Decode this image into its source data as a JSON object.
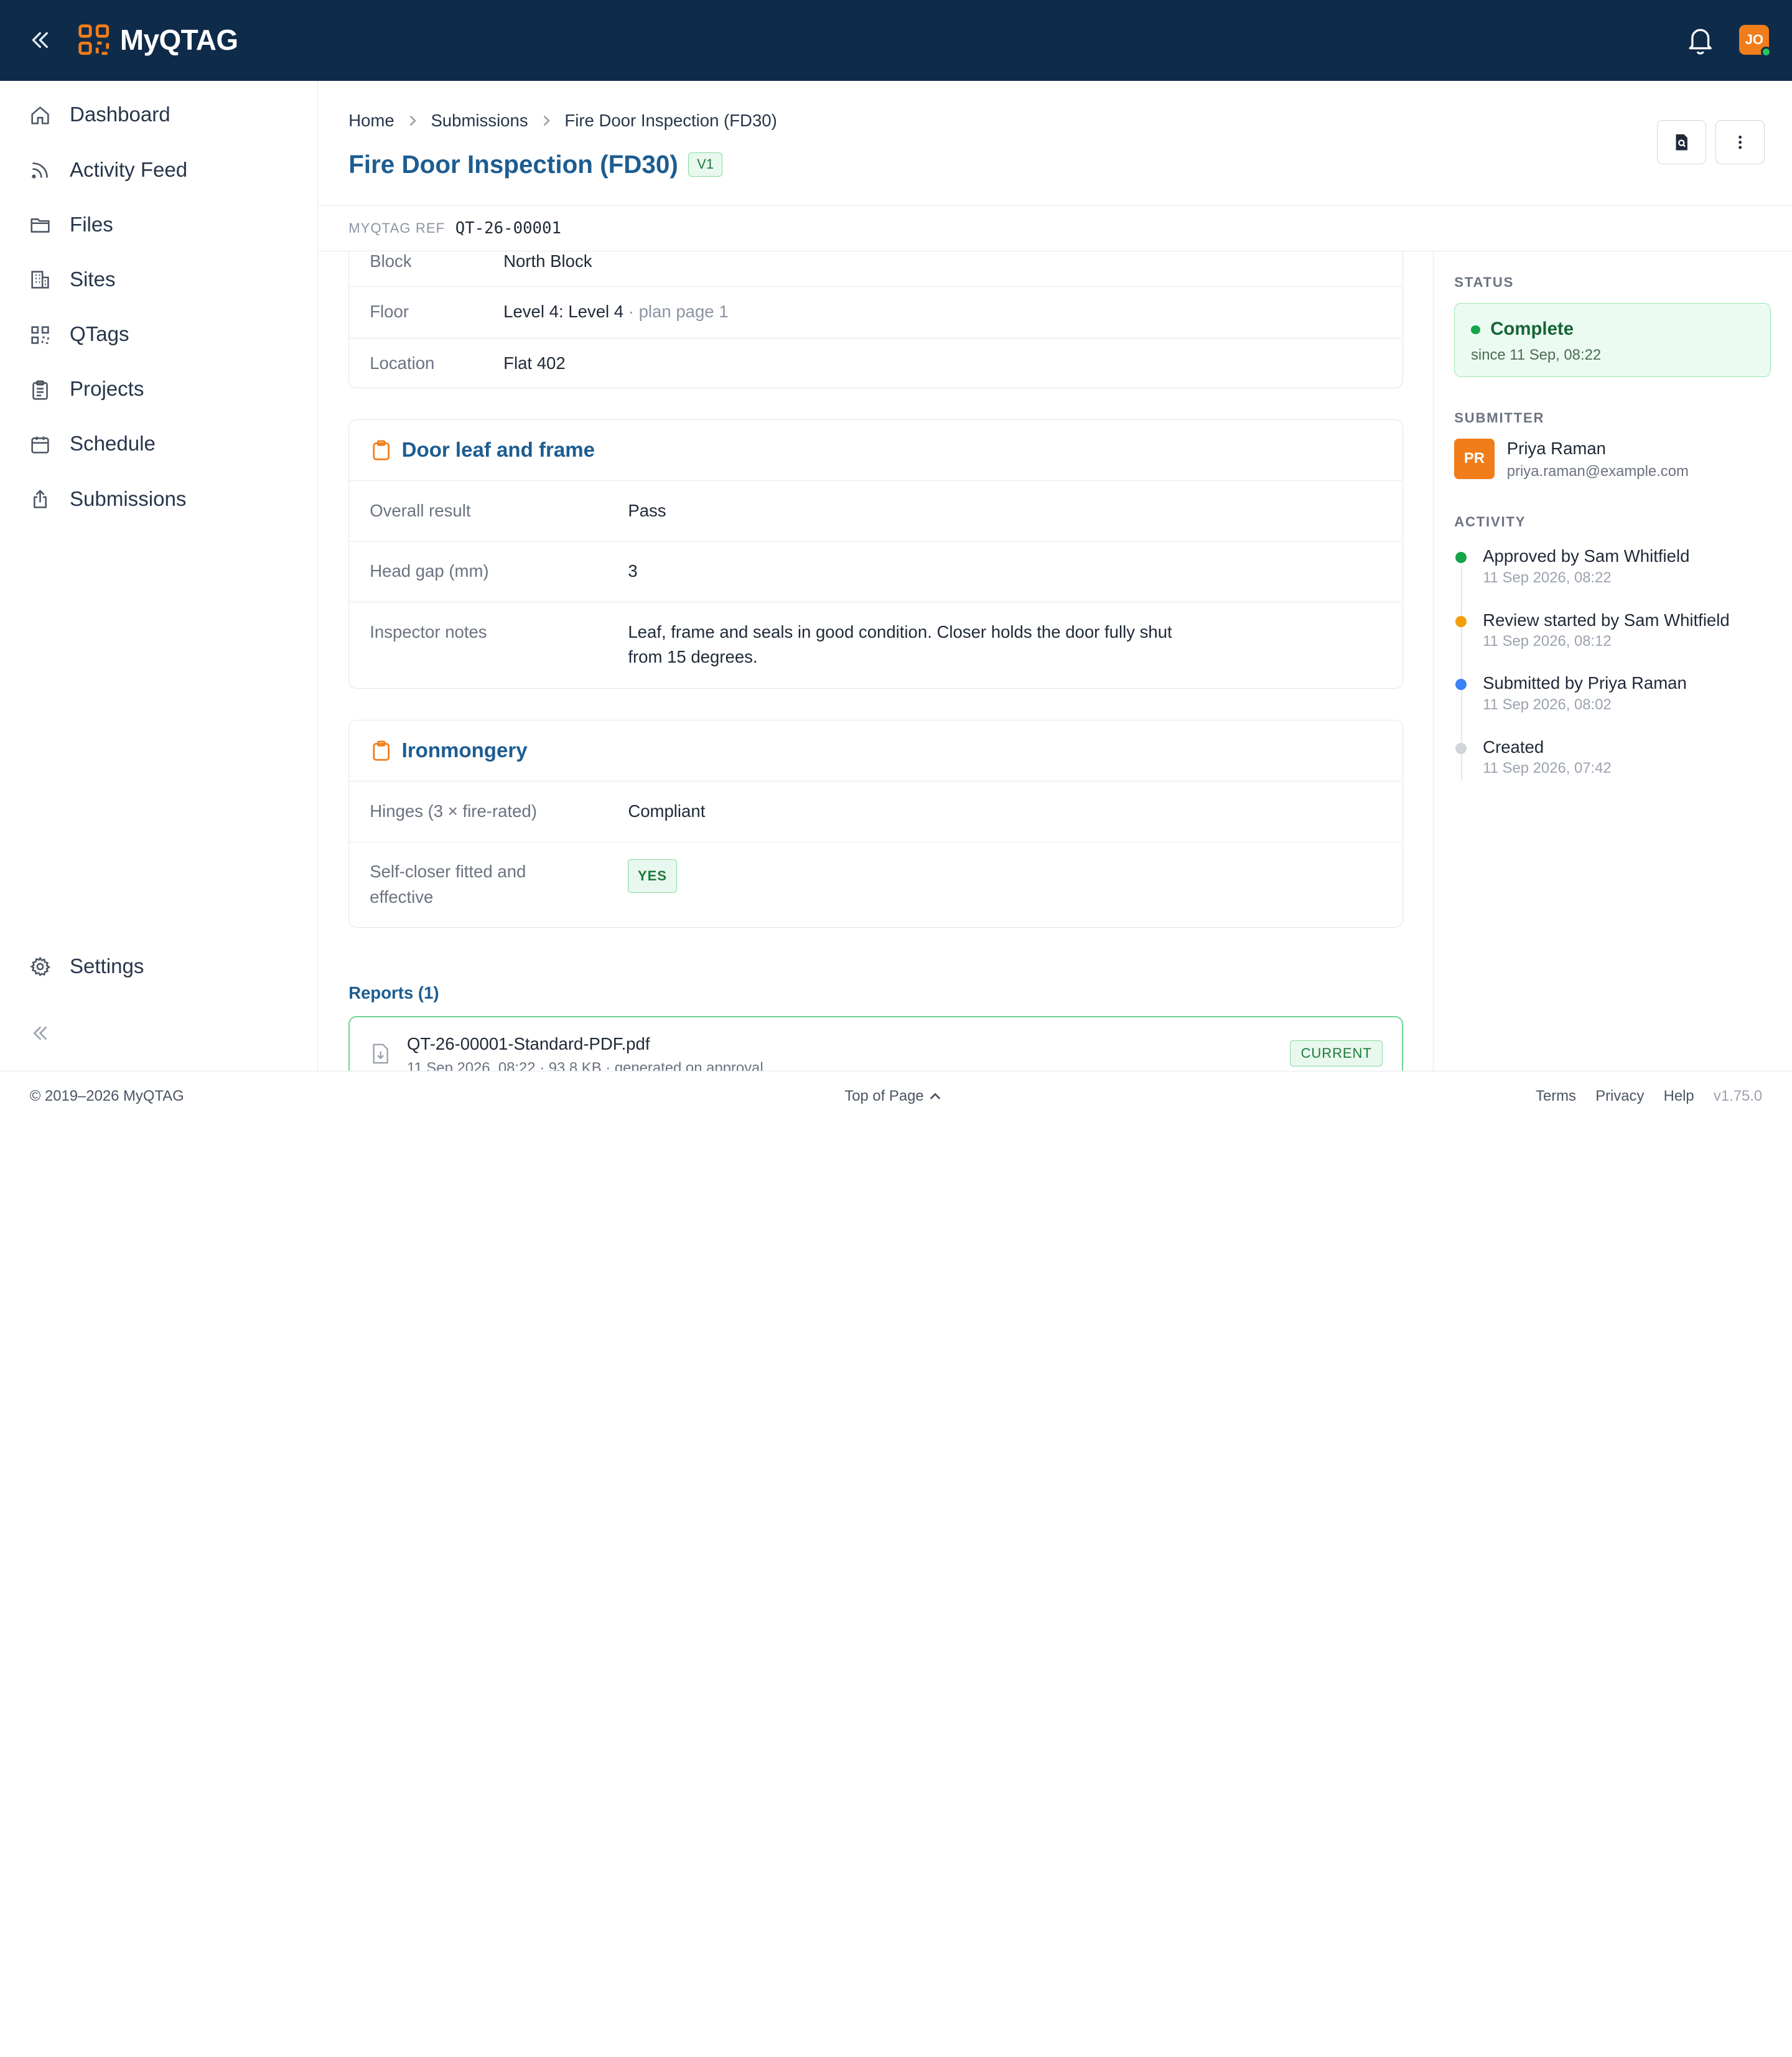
{
  "app": {
    "name": "MyQTAG",
    "user_initials": "JO"
  },
  "sidebar": {
    "items": [
      {
        "label": "Dashboard",
        "icon": "home-icon"
      },
      {
        "label": "Activity Feed",
        "icon": "rss-icon"
      },
      {
        "label": "Files",
        "icon": "folder-icon"
      },
      {
        "label": "Sites",
        "icon": "building-icon"
      },
      {
        "label": "QTags",
        "icon": "qr-icon"
      },
      {
        "label": "Projects",
        "icon": "clipboard-icon"
      },
      {
        "label": "Schedule",
        "icon": "calendar-icon"
      },
      {
        "label": "Submissions",
        "icon": "upload-icon"
      }
    ],
    "settings_label": "Settings"
  },
  "breadcrumb": [
    "Home",
    "Submissions",
    "Fire Door Inspection (FD30)"
  ],
  "page": {
    "title": "Fire Door Inspection (FD30)",
    "version": "V1"
  },
  "ref": {
    "label": "MYQTAG REF",
    "value": "QT-26-00001"
  },
  "location_fields": [
    {
      "key": "Block",
      "value": "North Block",
      "extra": ""
    },
    {
      "key": "Floor",
      "value": "Level 4: Level 4",
      "extra": " · plan page 1"
    },
    {
      "key": "Location",
      "value": "Flat 402",
      "extra": ""
    }
  ],
  "sections": [
    {
      "title": "Door leaf and frame",
      "rows": [
        {
          "key": "Overall result",
          "value": "Pass"
        },
        {
          "key": "Head gap (mm)",
          "value": "3"
        },
        {
          "key": "Inspector notes",
          "value": "Leaf, frame and seals in good condition. Closer holds the door fully shut",
          "value2": "from 15 degrees."
        }
      ]
    },
    {
      "title": "Ironmongery",
      "rows": [
        {
          "key": "Hinges (3 × fire-rated)",
          "value": "Compliant"
        },
        {
          "key": "Self-closer fitted and",
          "key2": "effective",
          "value": "YES"
        }
      ]
    }
  ],
  "reports": {
    "title": "Reports (1)",
    "items": [
      {
        "filename": "QT-26-00001-Standard-PDF.pdf",
        "meta": "11 Sep 2026, 08:22 · 93.8 KB · generated on approval",
        "badge": "CURRENT"
      }
    ]
  },
  "status": {
    "label": "STATUS",
    "value": "Complete",
    "since": "since 11 Sep, 08:22",
    "color": "#16a34a"
  },
  "submitter": {
    "label": "SUBMITTER",
    "initials": "PR",
    "name": "Priya Raman",
    "email": "priya.raman@example.com"
  },
  "activity": {
    "label": "ACTIVITY",
    "items": [
      {
        "action": "Approved",
        "by": " by Sam Whitfield",
        "time": "11 Sep 2026, 08:22",
        "color": "#16a34a"
      },
      {
        "action": "Review started",
        "by": " by Sam Whitfield",
        "time": "11 Sep 2026, 08:12",
        "color": "#f59e0b"
      },
      {
        "action": "Submitted",
        "by": " by Priya Raman",
        "time": "11 Sep 2026, 08:02",
        "color": "#3b82f6"
      },
      {
        "action": "Created",
        "by": "",
        "time": "11 Sep 2026, 07:42",
        "color": "#d1d5db"
      }
    ]
  },
  "footer": {
    "copyright": "© 2019–2026 MyQTAG",
    "top_of_page": "Top of Page",
    "links": [
      "Terms",
      "Privacy",
      "Help"
    ],
    "version": "v1.75.0"
  }
}
